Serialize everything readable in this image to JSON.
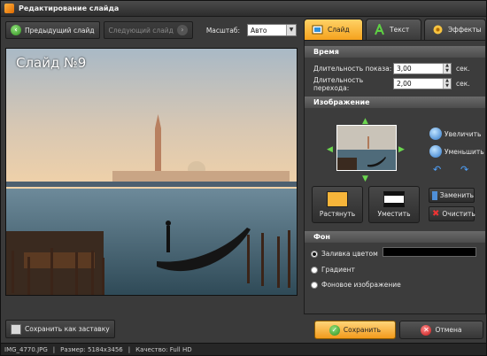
{
  "window": {
    "title": "Редактирование слайда"
  },
  "toolbar": {
    "prev_label": "Предыдущий слайд",
    "next_label": "Следующий слайд",
    "scale_label": "Масштаб:",
    "scale_value": "Авто"
  },
  "preview": {
    "slide_label": "Слайд №9"
  },
  "bottom_left": {
    "save_as_cover": "Сохранить как заставку"
  },
  "status": {
    "filename": "IMG_4770.JPG",
    "size": "Размер: 5184x3456",
    "quality": "Качество: Full HD"
  },
  "tabs": [
    {
      "label": "Слайд",
      "active": true
    },
    {
      "label": "Текст",
      "active": false
    },
    {
      "label": "Эффекты",
      "active": false
    }
  ],
  "time": {
    "header": "Время",
    "display_label": "Длительность показа:",
    "display_value": "3,00",
    "transition_label": "Длительность перехода:",
    "transition_value": "2,00",
    "unit": "сек."
  },
  "image": {
    "header": "Изображение",
    "zoom_in": "Увеличить",
    "zoom_out": "Уменьшить",
    "stretch": "Растянуть",
    "fit": "Уместить",
    "replace": "Заменить",
    "clear": "Очистить"
  },
  "background": {
    "header": "Фон",
    "fill_color": "Заливка цветом",
    "gradient": "Градиент",
    "bg_image": "Фоновое изображение",
    "selected": "fill_color",
    "swatch_color": "#000000"
  },
  "actions": {
    "save": "Сохранить",
    "cancel": "Отмена"
  },
  "colors": {
    "accent": "#f5a21d",
    "ok_green": "#3fa92a",
    "cancel_red": "#c21616"
  }
}
